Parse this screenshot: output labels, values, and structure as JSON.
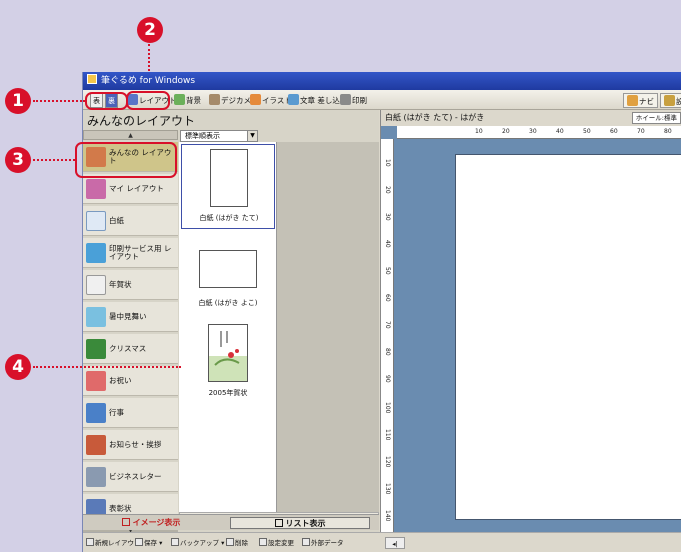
{
  "window": {
    "title": "筆ぐるめ for Windows"
  },
  "toolbar": {
    "mode_front": "表",
    "mode_back": "裏",
    "layout": "レイアウト",
    "background": "背景",
    "digicam": "デジカメ",
    "illust": "イラスト",
    "text_insert": "文章 差し込み",
    "print": "印刷",
    "navi": "ナビ",
    "settings": "設"
  },
  "left_panel": {
    "title": "みんなのレイアウト",
    "sort": "標準順表示",
    "categories": [
      {
        "label": "みんなの レイアウト",
        "icon": "people-icon"
      },
      {
        "label": "マイ レイアウト",
        "icon": "my-layout-icon"
      },
      {
        "label": "白紙",
        "icon": "blank-paper-icon"
      },
      {
        "label": "印刷サービス用 レイアウト",
        "icon": "print-service-icon"
      },
      {
        "label": "年賀状",
        "icon": "new-year-card-icon"
      },
      {
        "label": "暑中見舞い",
        "icon": "summer-greeting-icon"
      },
      {
        "label": "クリスマス",
        "icon": "christmas-tree-icon"
      },
      {
        "label": "お祝い",
        "icon": "celebration-icon"
      },
      {
        "label": "行事",
        "icon": "event-icon"
      },
      {
        "label": "お知らせ・挨拶",
        "icon": "announcement-icon"
      },
      {
        "label": "ビジネスレター",
        "icon": "business-letter-icon"
      },
      {
        "label": "表彰状",
        "icon": "certificate-icon"
      }
    ],
    "thumbnails": [
      {
        "caption": "白紙 (はがき たて)"
      },
      {
        "caption": "白紙 (はがき よこ)"
      },
      {
        "caption": "2005年賀状"
      }
    ],
    "view_image": "イメージ表示",
    "view_list": "リスト表示"
  },
  "bottom_bar": {
    "new_layout": "新規レイアウト",
    "save": "保存",
    "backup": "バックアップ",
    "delete": "削除",
    "settings_change": "設定変更",
    "external": "外部データ"
  },
  "document": {
    "title": "白紙 (はがき たて) - はがき",
    "wheel": "ホイール:標準",
    "ruler_h": [
      "10",
      "20",
      "30",
      "40",
      "50",
      "60",
      "70",
      "80"
    ],
    "ruler_v": [
      "10",
      "20",
      "30",
      "40",
      "50",
      "60",
      "70",
      "80",
      "90",
      "100",
      "110",
      "120",
      "130",
      "140"
    ]
  },
  "callouts": [
    "1",
    "2",
    "3",
    "4"
  ]
}
